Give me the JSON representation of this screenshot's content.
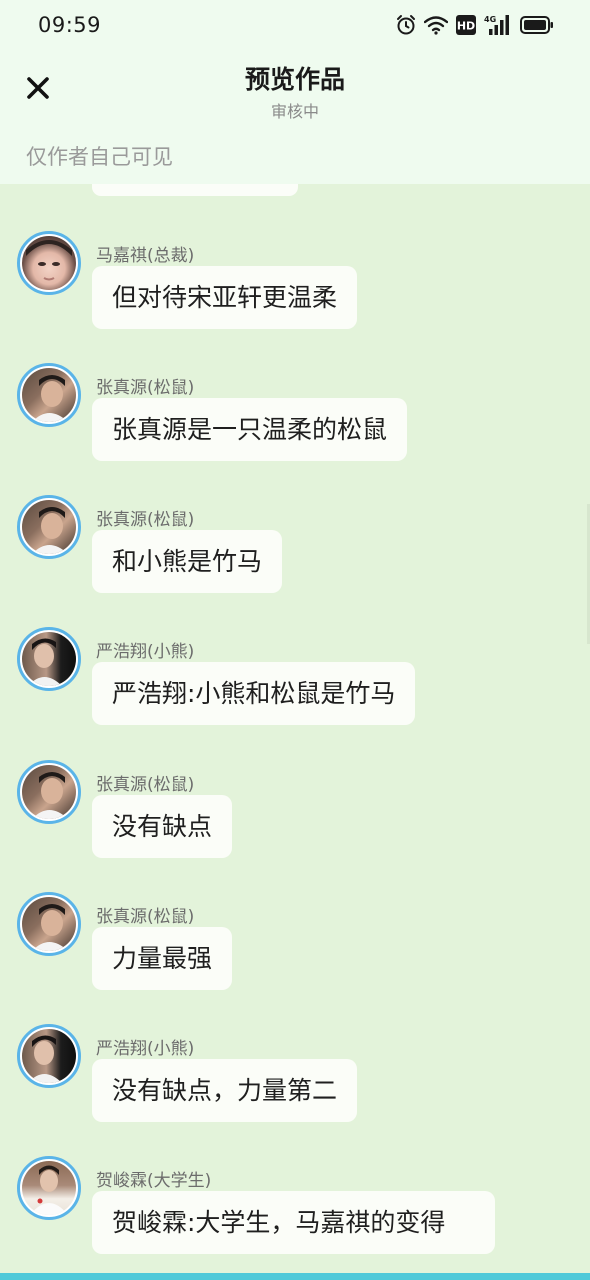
{
  "status_bar": {
    "time": "09:59",
    "icons": [
      "alarm-icon",
      "wifi-icon",
      "hd-icon",
      "4g-signal-icon",
      "battery-icon"
    ],
    "hd_label": "HD",
    "network_label": "4G"
  },
  "header": {
    "close_icon": "close-icon",
    "title": "预览作品",
    "subtitle": "审核中"
  },
  "visibility_note": "仅作者自己可见",
  "colors": {
    "page_background": "#e3f3da",
    "header_background": "#effbef",
    "bubble_background": "#fbfdf8",
    "avatar_border": "#5ab4e8",
    "accent_bottom": "#4fc9d9"
  },
  "messages": [
    {
      "sender": "马嘉祺(总裁)",
      "text": "但对待宋亚轩更温柔",
      "avatar": "avatar-majiaqi"
    },
    {
      "sender": "张真源(松鼠)",
      "text": "张真源是一只温柔的松鼠",
      "avatar": "avatar-zhangzhenyuan"
    },
    {
      "sender": "张真源(松鼠)",
      "text": "和小熊是竹马",
      "avatar": "avatar-zhangzhenyuan"
    },
    {
      "sender": "严浩翔(小熊)",
      "text": "严浩翔:小熊和松鼠是竹马",
      "avatar": "avatar-yanhaoxiang"
    },
    {
      "sender": "张真源(松鼠)",
      "text": "没有缺点",
      "avatar": "avatar-zhangzhenyuan"
    },
    {
      "sender": "张真源(松鼠)",
      "text": "力量最强",
      "avatar": "avatar-zhangzhenyuan"
    },
    {
      "sender": "严浩翔(小熊)",
      "text": "没有缺点，力量第二",
      "avatar": "avatar-yanhaoxiang"
    },
    {
      "sender": "贺峻霖(大学生)",
      "text": "贺峻霖:大学生，马嘉祺的变得",
      "avatar": "avatar-hejunlin"
    }
  ]
}
